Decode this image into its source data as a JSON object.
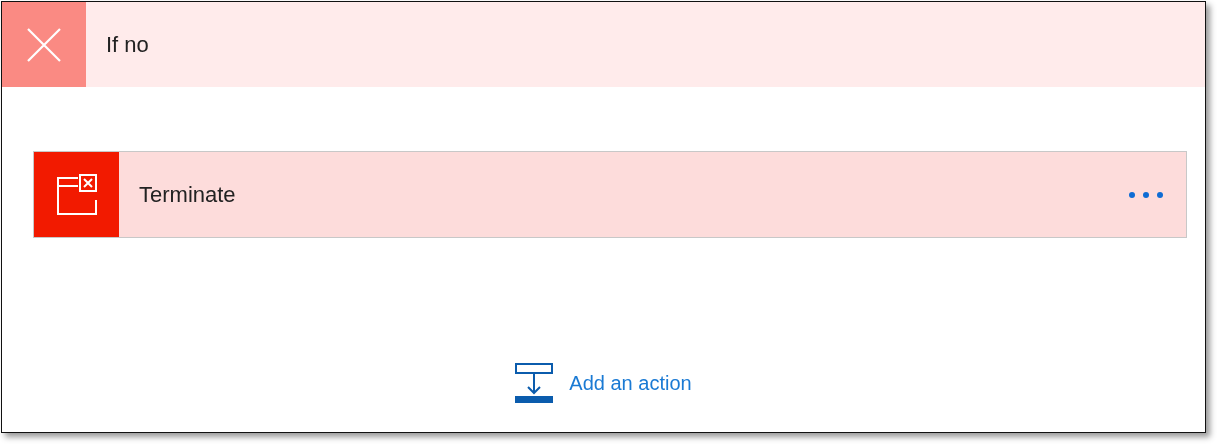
{
  "branch": {
    "title": "If no"
  },
  "actions": [
    {
      "title": "Terminate"
    }
  ],
  "add_action": {
    "label": "Add an action"
  }
}
